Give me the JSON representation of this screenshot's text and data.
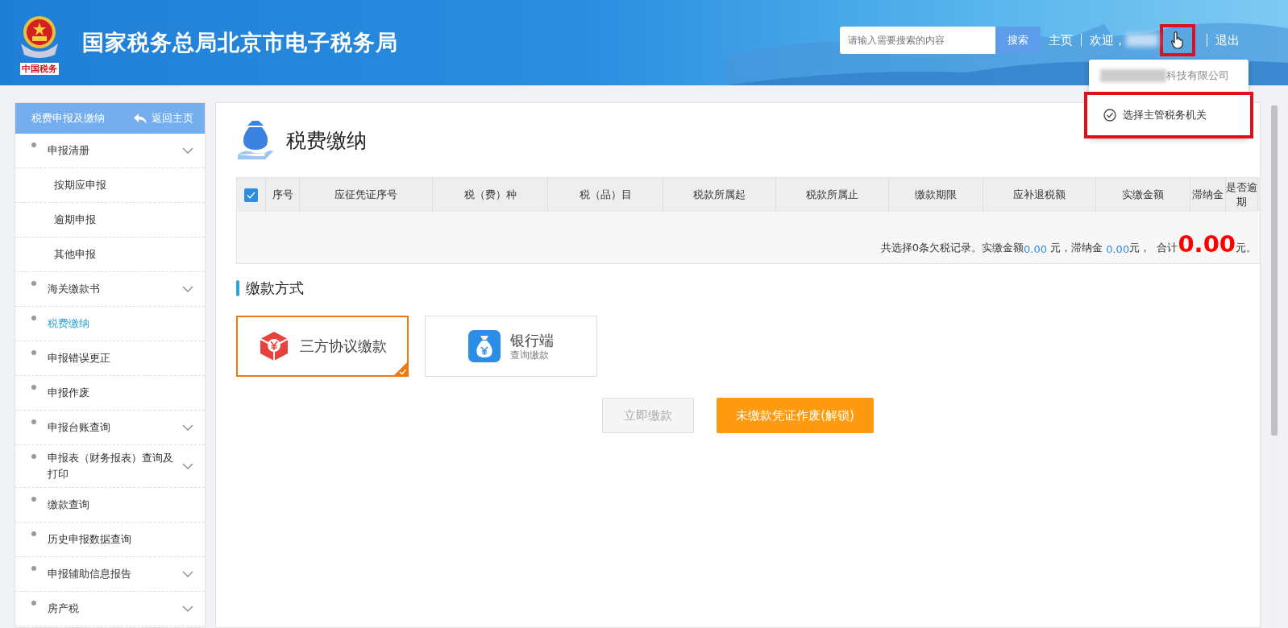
{
  "header": {
    "title": "国家税务总局北京市电子税务局",
    "logo_caption": "中国税务",
    "search": {
      "placeholder": "请输入需要搜索的内容",
      "button": "搜索"
    },
    "home_link": "主页",
    "welcome": "欢迎，",
    "logout": "退出",
    "user_menu": {
      "trigger_highlighted": true,
      "company": "科技有限公司",
      "items": [
        {
          "label": "选择主管税务机关",
          "highlighted": true
        }
      ]
    }
  },
  "sidebar": {
    "title": "税费申报及缴纳",
    "back": "返回主页",
    "items": [
      {
        "label": "申报清册",
        "expandable": true,
        "selected": false,
        "children": [
          {
            "label": "按期应申报",
            "selected": false
          },
          {
            "label": "逾期申报",
            "selected": false
          },
          {
            "label": "其他申报",
            "selected": false
          }
        ]
      },
      {
        "label": "海关缴款书",
        "expandable": true,
        "selected": false
      },
      {
        "label": "税费缴纳",
        "expandable": false,
        "selected": true
      },
      {
        "label": "申报错误更正",
        "expandable": false,
        "selected": false
      },
      {
        "label": "申报作废",
        "expandable": false,
        "selected": false
      },
      {
        "label": "申报台账查询",
        "expandable": true,
        "selected": false
      },
      {
        "label": "申报表（财务报表）查询及打印",
        "expandable": true,
        "selected": false
      },
      {
        "label": "缴款查询",
        "expandable": false,
        "selected": false
      },
      {
        "label": "历史申报数据查询",
        "expandable": false,
        "selected": false
      },
      {
        "label": "申报辅助信息报告",
        "expandable": true,
        "selected": false
      },
      {
        "label": "房产税",
        "expandable": true,
        "selected": false
      }
    ]
  },
  "main": {
    "title": "税费缴纳",
    "table": {
      "select_all_checked": true,
      "columns": [
        "序号",
        "应征凭证序号",
        "税（费）种",
        "税（品）目",
        "税款所属起",
        "税款所属止",
        "缴款期限",
        "应补退税额",
        "实缴金额",
        "滞纳金",
        "是否逾期"
      ],
      "summary": [
        {
          "kind": "text",
          "text": "共选择0条欠税记录。实缴金额"
        },
        {
          "kind": "amount",
          "text": "0.00"
        },
        {
          "kind": "text",
          "text": " 元，滞纳金 "
        },
        {
          "kind": "amount",
          "text": "0.00"
        },
        {
          "kind": "text",
          "text": "元，  合计"
        },
        {
          "kind": "total",
          "text": "0.00"
        },
        {
          "kind": "text",
          "text": "元。"
        }
      ]
    },
    "payment": {
      "title": "缴款方式",
      "methods": [
        {
          "kind": "agreement",
          "label": "三方协议缴款",
          "selected": true
        },
        {
          "kind": "bank",
          "label": "银行端",
          "sublabel": "查询缴款",
          "selected": false
        }
      ],
      "buttons": [
        {
          "label": "立即缴款",
          "disabled": true
        },
        {
          "label": "未缴款凭证作废(解锁)",
          "disabled": false
        }
      ]
    }
  }
}
